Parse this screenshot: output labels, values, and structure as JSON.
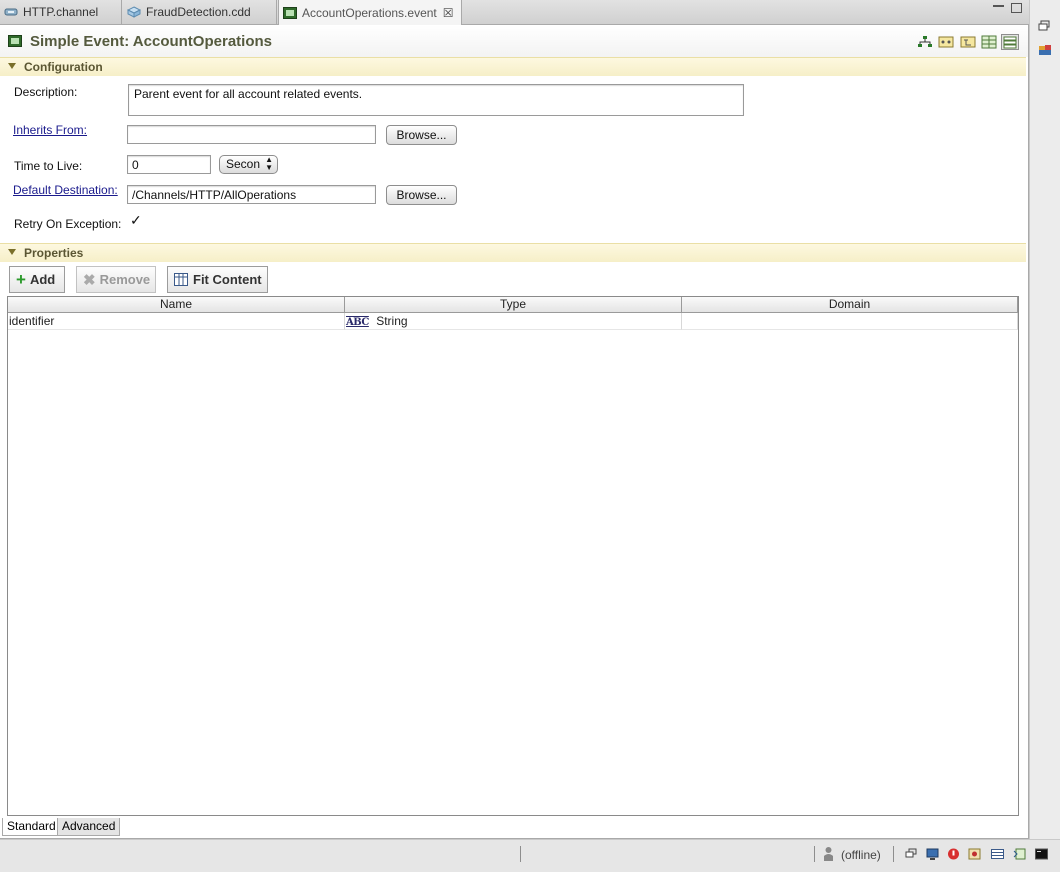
{
  "tabs": [
    {
      "label": "HTTP.channel",
      "icon": "channel-icon"
    },
    {
      "label": "FraudDetection.cdd",
      "icon": "cluster-deployment-icon"
    },
    {
      "label": "AccountOperations.event",
      "icon": "event-icon",
      "close": "☒"
    }
  ],
  "form": {
    "title": "Simple Event: AccountOperations",
    "toolbar_icons": [
      "hierarchy-icon",
      "dependency-icon",
      "tree-icon",
      "columns-icon",
      "list-icon"
    ]
  },
  "configuration": {
    "section_title": "Configuration",
    "description_label": "Description:",
    "description_value": "Parent event for all account related events.",
    "inherits_label": "Inherits From:",
    "inherits_value": "",
    "browse_label": "Browse...",
    "ttl_label": "Time to Live:",
    "ttl_value": "0",
    "ttl_unit": "Secon",
    "destination_label": "Default Destination:",
    "destination_value": "/Channels/HTTP/AllOperations",
    "retry_label": "Retry On Exception:",
    "retry_checked": "✓"
  },
  "properties": {
    "section_title": "Properties",
    "add_label": "Add",
    "remove_label": "Remove",
    "fit_label": "Fit Content",
    "columns": [
      "Name",
      "Type",
      "Domain"
    ],
    "rows": [
      {
        "name": "identifier",
        "type_icon": "ABC",
        "type": "String",
        "domain": ""
      }
    ]
  },
  "page_tabs": [
    "Standard",
    "Advanced"
  ],
  "statusbar": {
    "status": "(offline)"
  },
  "colors": {
    "title": "#555a3e",
    "section_bg": "#f6efc8",
    "link": "#1a1a8c"
  }
}
